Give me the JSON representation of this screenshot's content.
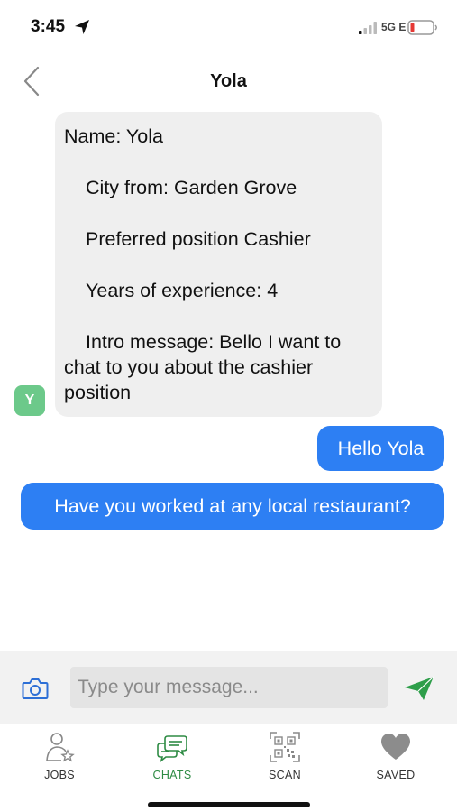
{
  "status_bar": {
    "time": "3:45",
    "network": "5G E"
  },
  "header": {
    "title": "Yola"
  },
  "messages": {
    "received": {
      "avatar_initial": "Y",
      "name_line": "Name: Yola",
      "city_line": "City from: Garden Grove",
      "position_line": "Preferred position Cashier",
      "experience_line": "Years of experience: 4",
      "intro_line": "Intro message: Bello I want to chat to you about the cashier position"
    },
    "sent": [
      {
        "text": "Hello Yola"
      },
      {
        "text": "Have you worked at any local restaurant?"
      }
    ]
  },
  "composer": {
    "placeholder": "Type your message..."
  },
  "tabs": [
    {
      "label": "JOBS"
    },
    {
      "label": "CHATS",
      "active": true
    },
    {
      "label": "SCAN"
    },
    {
      "label": "SAVED"
    }
  ],
  "colors": {
    "accent": "#2d7ff3",
    "active_tab": "#2e8b44",
    "send": "#2e9e4a",
    "avatar": "#6cc98a",
    "received_bubble": "#efefef",
    "battery_low": "#e53935"
  }
}
